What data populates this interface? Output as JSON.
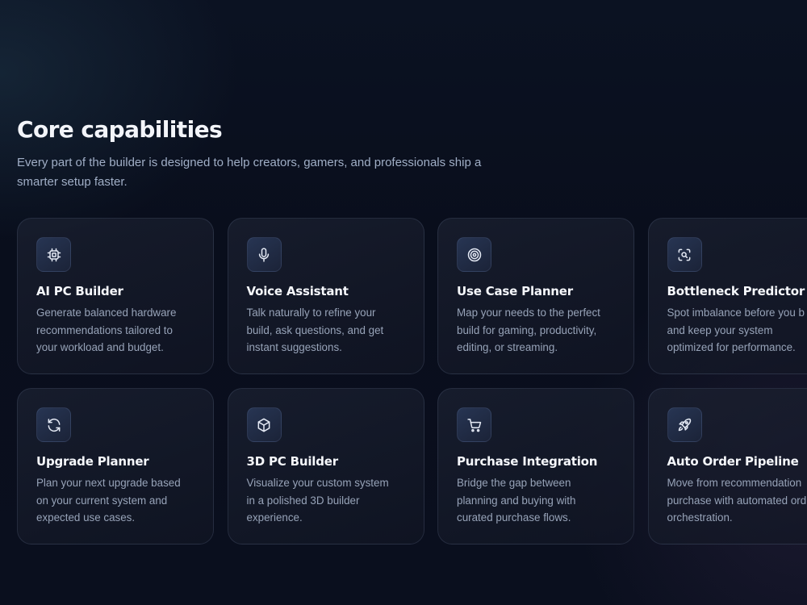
{
  "section": {
    "title": "Core capabilities",
    "subtitle": "Every part of the builder is designed to help creators, gamers, and professionals ship a smarter setup faster."
  },
  "cards": [
    {
      "icon": "cpu-chip-icon",
      "title": "AI PC Builder",
      "lines": [
        "Generate balanced hardware",
        "recommendations tailored to",
        "your workload and budget."
      ]
    },
    {
      "icon": "microphone-icon",
      "title": "Voice Assistant",
      "lines": [
        "Talk naturally to refine your",
        "build, ask questions, and get",
        "instant suggestions."
      ]
    },
    {
      "icon": "target-icon",
      "title": "Use Case Planner",
      "lines": [
        "Map your needs to the perfect",
        "build for gaming, productivity,",
        "editing, or streaming."
      ]
    },
    {
      "icon": "scan-search-icon",
      "title": "Bottleneck Predictor",
      "lines": [
        "Spot imbalance before you b",
        "and keep your system",
        "optimized for performance."
      ]
    },
    {
      "icon": "refresh-icon",
      "title": "Upgrade Planner",
      "lines": [
        "Plan your next upgrade based",
        "on your current system and",
        "expected use cases."
      ]
    },
    {
      "icon": "cube-icon",
      "title": "3D PC Builder",
      "lines": [
        "Visualize your custom system",
        "in a polished 3D builder",
        "experience."
      ]
    },
    {
      "icon": "shopping-cart-icon",
      "title": "Purchase Integration",
      "lines": [
        "Bridge the gap between",
        "planning and buying with",
        "curated purchase flows."
      ]
    },
    {
      "icon": "rocket-icon",
      "title": "Auto Order Pipeline",
      "lines": [
        "Move from recommendation",
        "purchase with automated ord",
        "orchestration."
      ]
    }
  ],
  "colors": {
    "background": "#0a0f1e",
    "card_border": "#2a3347",
    "icon_box": "#273553",
    "title_text": "#f3f5fa",
    "body_text": "#97a3b8"
  }
}
